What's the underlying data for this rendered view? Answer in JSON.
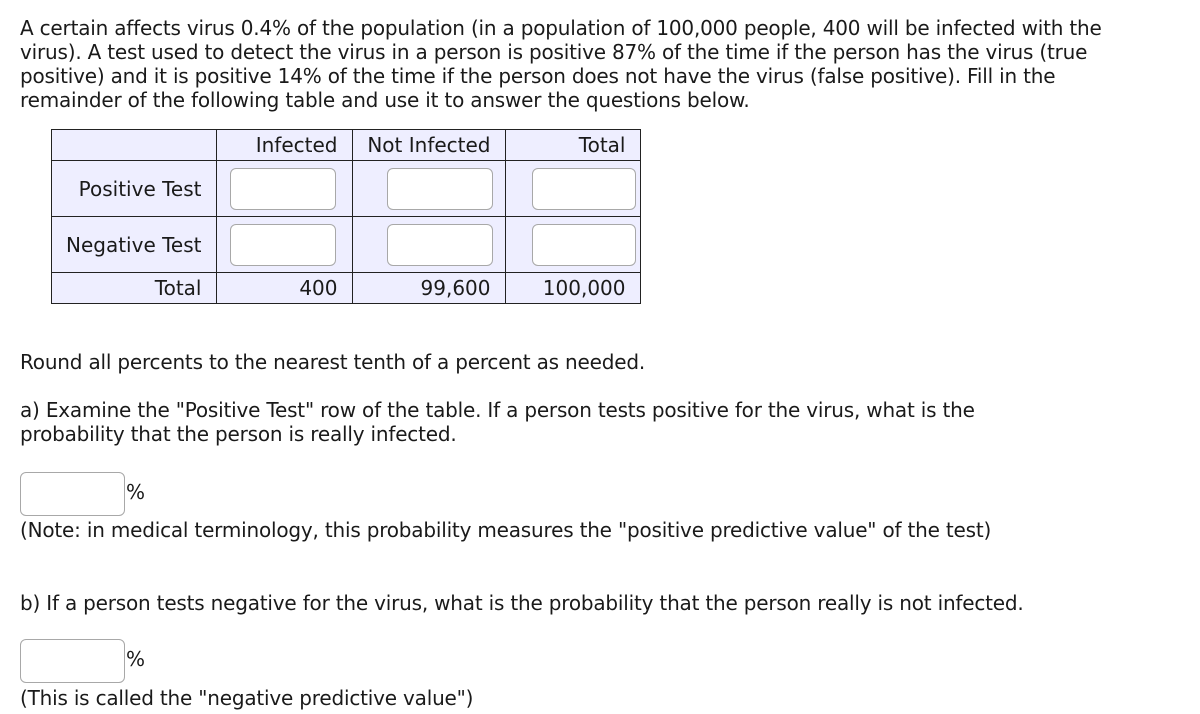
{
  "problem": {
    "intro": "A certain affects virus 0.4% of the population (in a population of 100,000 people, 400 will be infected with the virus). A test used to detect the virus in a person is positive 87% of the time if the person has the virus (true positive) and it is positive 14% of the time if the person does not have the virus (false positive). Fill in the remainder of the following table and use it to answer the questions below."
  },
  "table": {
    "headers": [
      "",
      "Infected",
      "Not Infected",
      "Total"
    ],
    "rows": [
      {
        "label": "Positive Test",
        "cells": [
          "",
          "",
          ""
        ]
      },
      {
        "label": "Negative Test",
        "cells": [
          "",
          "",
          ""
        ]
      },
      {
        "label": "Total",
        "cells": [
          "400",
          "99,600",
          "100,000"
        ]
      }
    ]
  },
  "instructions": "Round all percents to the nearest tenth of a percent as needed.",
  "question_a": {
    "text": "a) Examine the \"Positive Test\" row of the table.  If a person tests positive for the virus, what is the probability that the person is really infected.",
    "answer_value": "",
    "unit": "%",
    "note": "(Note: in medical terminology, this probability measures the \"positive predictive value\" of the test)"
  },
  "question_b": {
    "text": "b) If a person tests negative for the virus, what is the probability that the person really is not infected.",
    "answer_value": "",
    "unit": "%",
    "note": "(This is called the \"negative predictive value\")"
  }
}
